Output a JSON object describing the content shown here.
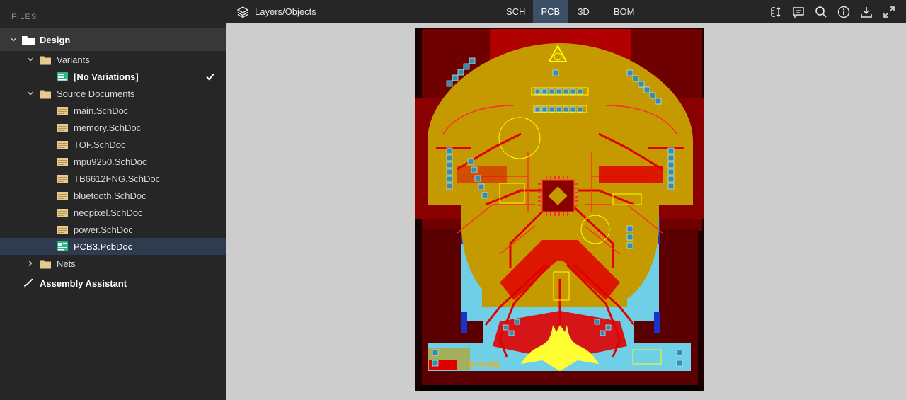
{
  "sidebar": {
    "header": "FILES",
    "root": {
      "label": "Design"
    },
    "variants": {
      "label": "Variants",
      "child": "[No Variations]"
    },
    "source_documents": {
      "label": "Source Documents",
      "files": [
        "main.SchDoc",
        "memory.SchDoc",
        "TOF.SchDoc",
        "mpu9250.SchDoc",
        "TB6612FNG.SchDoc",
        "bluetooth.SchDoc",
        "neopixel.SchDoc",
        "power.SchDoc"
      ],
      "pcb_file": "PCB3.PcbDoc"
    },
    "nets": {
      "label": "Nets"
    },
    "assembly": {
      "label": "Assembly Assistant"
    }
  },
  "toolbar": {
    "layers_label": "Layers/Objects",
    "tabs": [
      "SCH",
      "PCB",
      "3D",
      "BOM"
    ],
    "active_tab": "PCB",
    "tools": [
      "measure-icon",
      "comment-icon",
      "search-icon",
      "info-icon",
      "download-icon",
      "fullscreen-icon"
    ]
  },
  "board": {
    "logo_text": "Mebotix",
    "colors": {
      "substrate": "#6e0000",
      "top_copper": "#c49a00",
      "traces": "#e00000",
      "bottom_copper": "#6fcfe7",
      "silkscreen": "#ffff00"
    }
  }
}
